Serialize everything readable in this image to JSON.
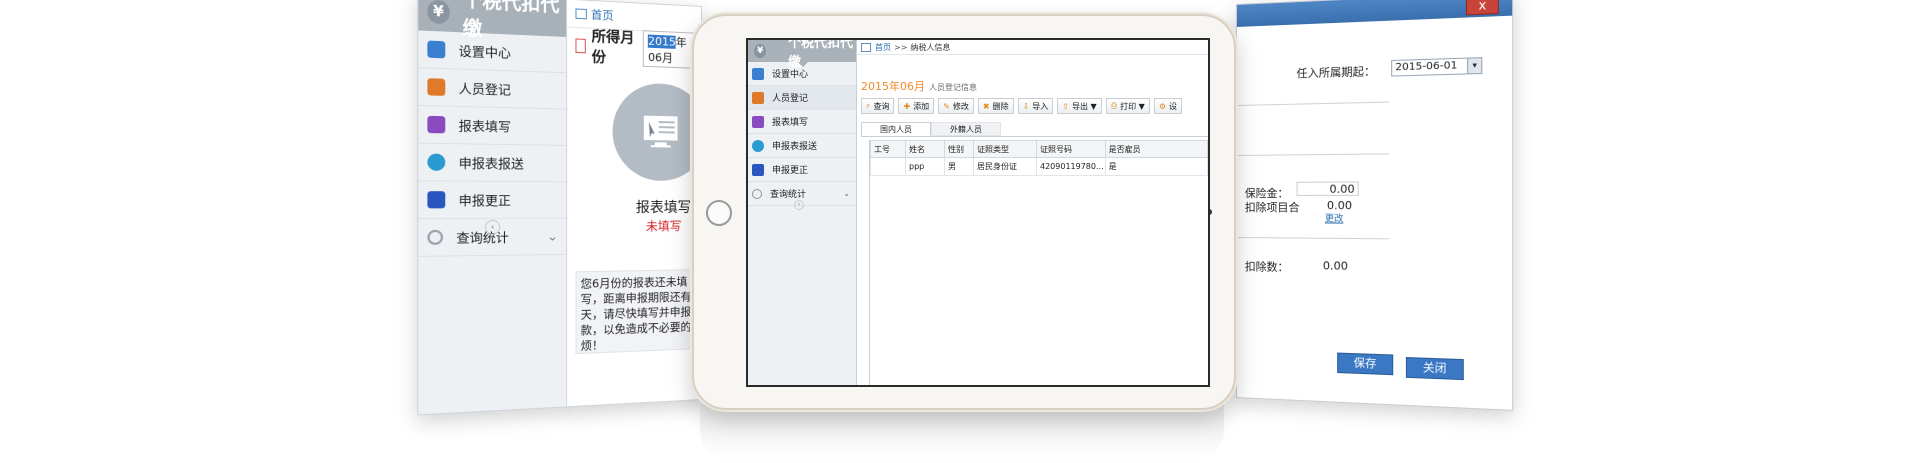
{
  "left_screen": {
    "app_title": "个税代扣代缴",
    "nav": [
      {
        "label": "设置中心",
        "color": "#3a7fd0"
      },
      {
        "label": "人员登记",
        "color": "#e07a2a"
      },
      {
        "label": "报表填写",
        "color": "#8a4ac0"
      },
      {
        "label": "申报表报送",
        "color": "#2a9bd0"
      },
      {
        "label": "申报更正",
        "color": "#2a56c0"
      },
      {
        "label": "查询统计",
        "color": "#9aa3ad"
      }
    ],
    "breadcrumb_home": "首页",
    "period_label": "所得月份",
    "period_year": "2015",
    "period_month": "年06月",
    "tile_caption": "报表填写",
    "tile_status": "未填写",
    "notice": "您6月份的报表还未填写，距离申报期限还有5天，请尽快填写并申报缴款，以免造成不必要的麻烦！"
  },
  "tablet": {
    "app_title": "个税代扣代缴",
    "nav": [
      {
        "label": "设置中心",
        "color": "#3a7fd0",
        "chevron": ""
      },
      {
        "label": "人员登记",
        "color": "#e07a2a",
        "chevron": ""
      },
      {
        "label": "报表填写",
        "color": "#8a4ac0",
        "chevron": ""
      },
      {
        "label": "申报表报送",
        "color": "#2a9bd0",
        "chevron": ""
      },
      {
        "label": "申报更正",
        "color": "#2a56c0",
        "chevron": ""
      },
      {
        "label": "查询统计",
        "color": "#9aa3ad",
        "chevron": "⌄"
      }
    ],
    "breadcrumb": {
      "home": "首页",
      "sep": ">>",
      "current": "纳税人信息"
    },
    "page_title": "2015年06月",
    "page_subtitle": "人员登记信息",
    "toolbar": [
      {
        "label": "查询",
        "icon": "⌕"
      },
      {
        "label": "添加",
        "icon": "✚"
      },
      {
        "label": "修改",
        "icon": "✎"
      },
      {
        "label": "删除",
        "icon": "✖"
      },
      {
        "label": "导入",
        "icon": "⇩"
      },
      {
        "label": "导出 ▼",
        "icon": "⇧"
      },
      {
        "label": "打印 ▼",
        "icon": "⎙"
      },
      {
        "label": "设",
        "icon": "⚙"
      }
    ],
    "tabs": [
      "国内人员",
      "外籍人员"
    ],
    "table": {
      "headers": [
        "工号",
        "姓名",
        "性别",
        "证照类型",
        "证照号码",
        "是否雇员"
      ],
      "rows": [
        [
          "",
          "ppp",
          "男",
          "居民身份证",
          "42090119780...",
          "是"
        ]
      ]
    }
  },
  "right_dialog": {
    "close_symbol": "x",
    "date_label": "任入所属期起：",
    "date_value": "2015-06-01",
    "date_arrow": "▾",
    "row1_label": "保险金：",
    "row1_value": "0.00",
    "row2_label": "扣除项目合",
    "row2_value": "0.00",
    "row2_link": "更改",
    "row3_label": "扣除数：",
    "row3_value": "0.00",
    "save_label": "保存",
    "close_label": "关闭"
  }
}
